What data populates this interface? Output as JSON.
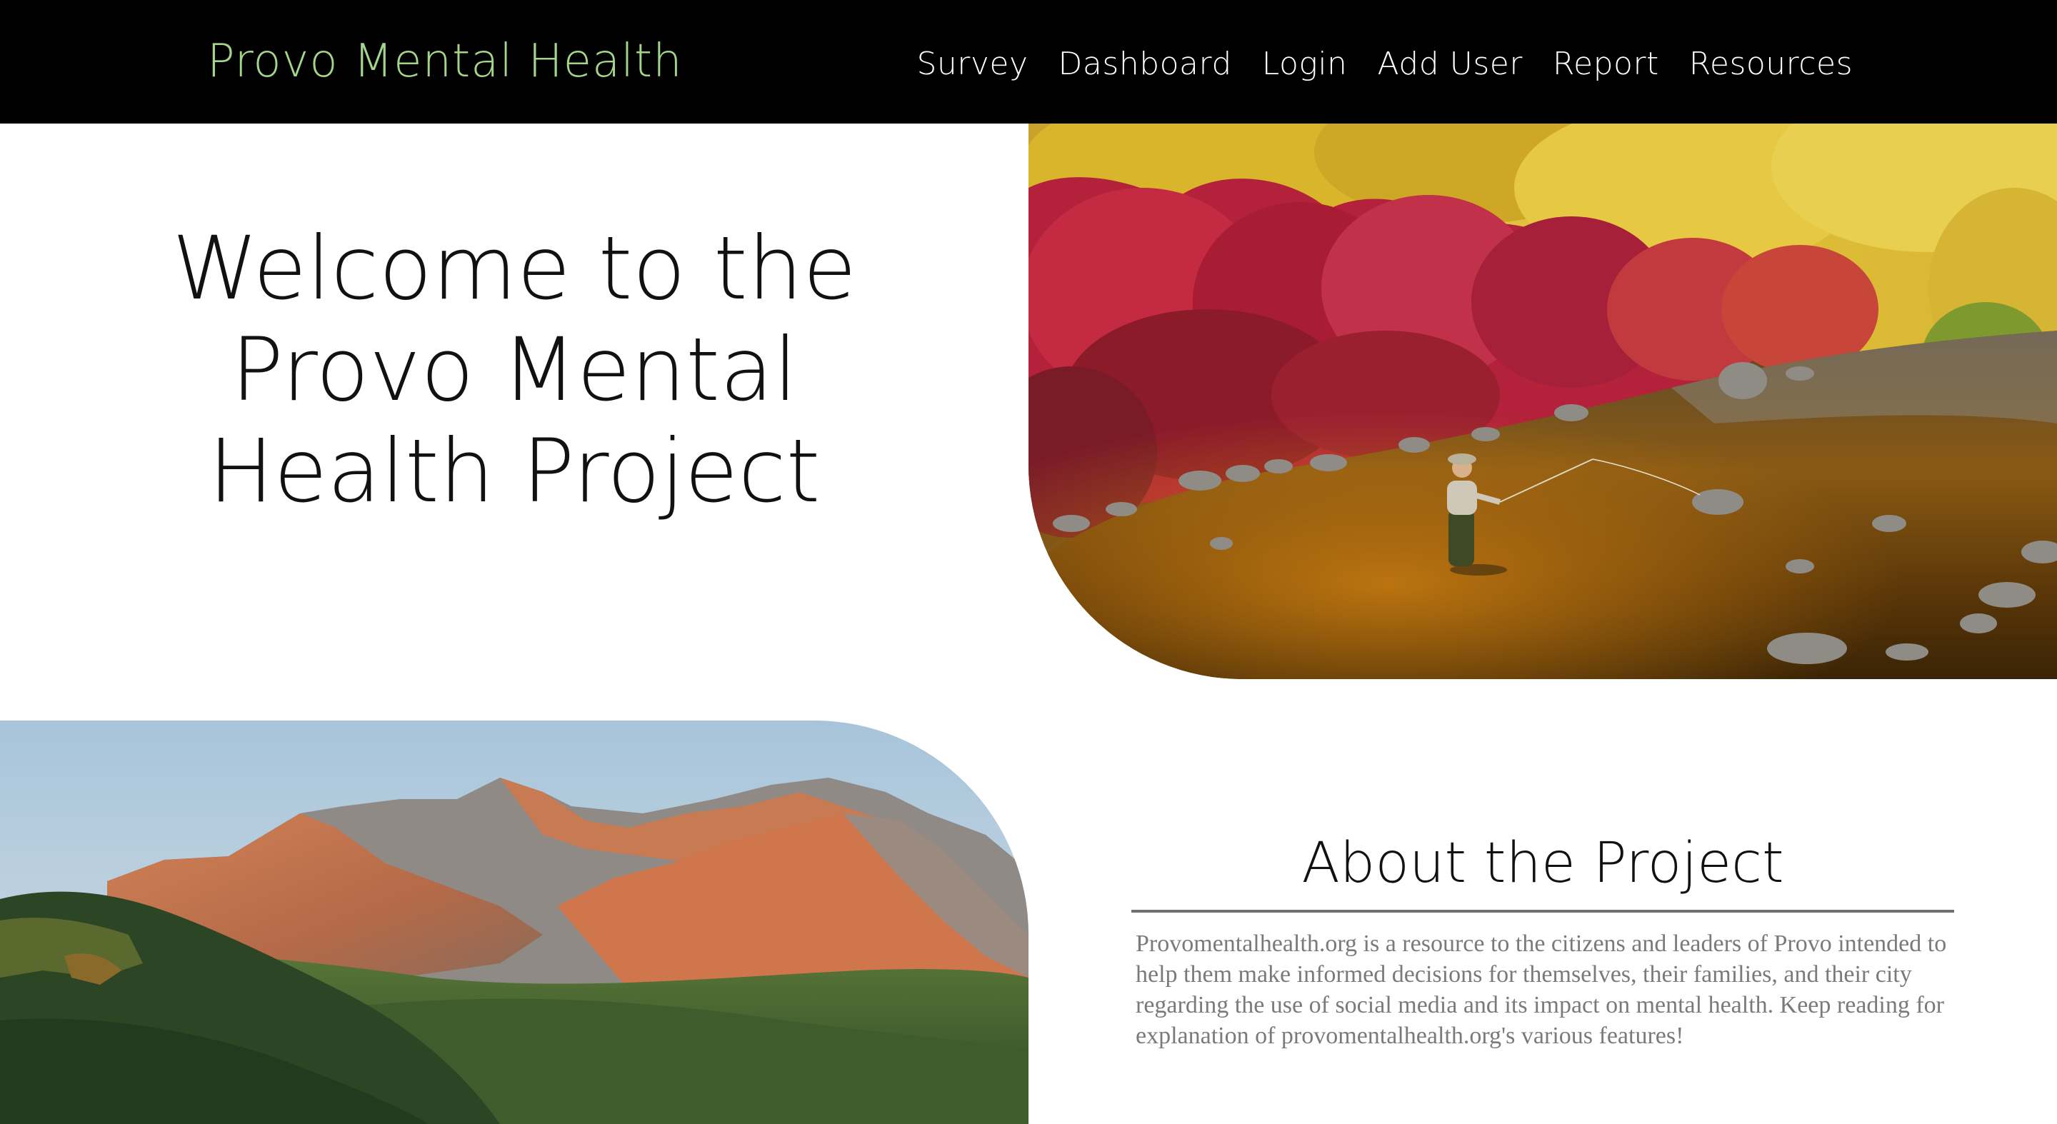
{
  "navbar": {
    "brand": "Provo Mental Health",
    "links": [
      {
        "label": "Survey"
      },
      {
        "label": "Dashboard"
      },
      {
        "label": "Login"
      },
      {
        "label": "Add User"
      },
      {
        "label": "Report"
      },
      {
        "label": "Resources"
      }
    ]
  },
  "hero": {
    "title_lines": [
      "Welcome to the",
      "Provo Mental",
      "Health Project"
    ],
    "image": "fly-fishing-autumn-river-photo"
  },
  "mountain": {
    "image": "mountain-landscape-sunrise-photo"
  },
  "about": {
    "heading": "About the Project",
    "body": "Provomentalhealth.org is a resource to the citizens and leaders of Provo intended to help them make informed decisions for themselves, their families, and their city regarding the use of social media and its impact on mental health. Keep reading for explanation of provomentalhealth.org's various features!"
  },
  "colors": {
    "navbar_bg": "#000000",
    "brand": "#a4d68a",
    "nav_link": "#ffffff",
    "body_text": "#7a7a7a"
  }
}
